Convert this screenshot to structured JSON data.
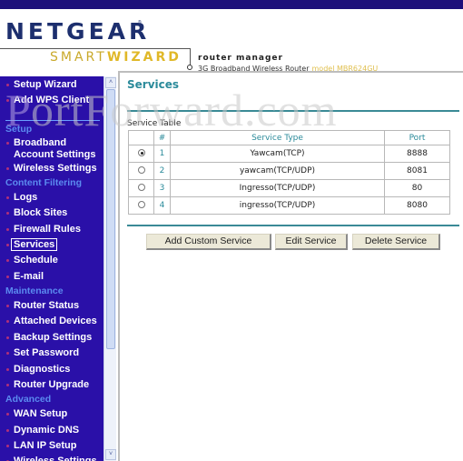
{
  "header": {
    "brand": "NETGEAR",
    "reg_mark": "®",
    "smart": "SMART",
    "wizard": "WIZARD",
    "router_manager": "router manager",
    "product": "3G Broadband Wireless Router",
    "model": "model MBR624GU"
  },
  "sidebar": {
    "items": [
      {
        "label": "Setup Wizard"
      },
      {
        "label": "Add WPS Client"
      },
      {
        "section": "Setup"
      },
      {
        "label": "Broadband Account Settings"
      },
      {
        "label": "Wireless Settings"
      },
      {
        "section": "Content Filtering"
      },
      {
        "label": "Logs"
      },
      {
        "label": "Block Sites"
      },
      {
        "label": "Firewall Rules"
      },
      {
        "label": "Services",
        "active": true
      },
      {
        "label": "Schedule"
      },
      {
        "label": "E-mail"
      },
      {
        "section": "Maintenance"
      },
      {
        "label": "Router Status"
      },
      {
        "label": "Attached Devices"
      },
      {
        "label": "Backup Settings"
      },
      {
        "label": "Set Password"
      },
      {
        "label": "Diagnostics"
      },
      {
        "label": "Router Upgrade"
      },
      {
        "section": "Advanced"
      },
      {
        "label": "WAN Setup"
      },
      {
        "label": "Dynamic DNS"
      },
      {
        "label": "LAN IP Setup"
      },
      {
        "label": "Wireless Settings"
      }
    ],
    "labels": {
      "setup_wizard": "Setup Wizard",
      "add_wps": "Add WPS Client",
      "sec_setup": "Setup",
      "broadband1": "Broadband",
      "broadband2": "Account Settings",
      "wireless": "Wireless Settings",
      "sec_content": "Content Filtering",
      "logs": "Logs",
      "block_sites": "Block Sites",
      "firewall": "Firewall Rules",
      "services": "Services",
      "schedule": "Schedule",
      "email": "E-mail",
      "sec_maint": "Maintenance",
      "router_status": "Router Status",
      "attached": "Attached Devices",
      "backup": "Backup Settings",
      "set_password": "Set Password",
      "diagnostics": "Diagnostics",
      "upgrade": "Router Upgrade",
      "sec_adv": "Advanced",
      "wan": "WAN Setup",
      "ddns": "Dynamic DNS",
      "lan": "LAN IP Setup",
      "wireless2": "Wireless Settings"
    }
  },
  "scrollbar": {
    "up": "˄",
    "down": "˅"
  },
  "main": {
    "title": "Services",
    "table_label": "Service Table",
    "columns": [
      "",
      "#",
      "Service Type",
      "Port"
    ],
    "rows": [
      {
        "selected": true,
        "num": "1",
        "type": "Yawcam(TCP)",
        "port": "8888"
      },
      {
        "selected": false,
        "num": "2",
        "type": "yawcam(TCP/UDP)",
        "port": "8081"
      },
      {
        "selected": false,
        "num": "3",
        "type": "Ingresso(TCP/UDP)",
        "port": "80"
      },
      {
        "selected": false,
        "num": "4",
        "type": "ingresso(TCP/UDP)",
        "port": "8080"
      }
    ],
    "buttons": {
      "add": "Add Custom Service",
      "edit": "Edit Service",
      "delete": "Delete Service"
    }
  },
  "watermark": {
    "p": "P",
    "rest": "ortForward.com"
  }
}
